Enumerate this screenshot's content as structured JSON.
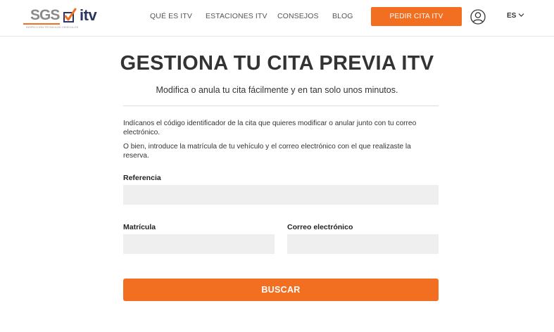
{
  "header": {
    "logo": {
      "sgs_text": "SGS",
      "subtitle": "INSPECCIÓN TÉCNICA DE VEHÍCULOS",
      "itv_text": "itv"
    },
    "nav": [
      {
        "label": "QUÉ ES ITV"
      },
      {
        "label": "ESTACIONES ITV"
      },
      {
        "label": "CONSEJOS"
      },
      {
        "label": "BLOG"
      }
    ],
    "cta_label": "PEDIR CITA ITV",
    "user_icon": "user-icon",
    "language": "ES"
  },
  "main": {
    "title": "GESTIONA TU CITA PREVIA ITV",
    "subtitle": "Modifica o anula tu cita fácilmente y en tan solo unos minutos.",
    "paragraph_1": "Indícanos el código identificador de la cita que quieres modificar o anular junto con tu correo electrónico.",
    "paragraph_2": "O bien, introduce la matrícula de tu vehículo y el correo electrónico con el que realizaste la reserva.",
    "form": {
      "referencia_label": "Referencia",
      "referencia_value": "",
      "matricula_label": "Matrícula",
      "matricula_value": "",
      "correo_label": "Correo electrónico",
      "correo_value": "",
      "submit_label": "BUSCAR"
    }
  },
  "colors": {
    "accent": "#f26f21",
    "brand_dark": "#2b3560",
    "field_bg": "#efefef"
  }
}
